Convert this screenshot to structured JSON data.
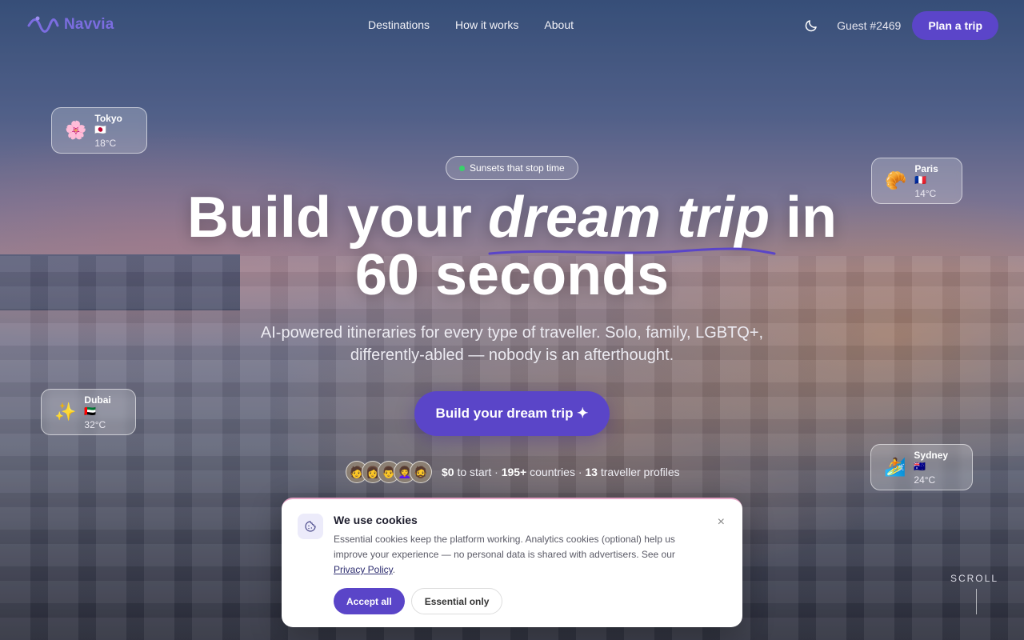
{
  "brand": {
    "name": "Navvia",
    "accent": "#5a45c8"
  },
  "nav": {
    "links": [
      "Destinations",
      "How it works",
      "About"
    ],
    "theme_icon": "moon-icon",
    "guest_label": "Guest #2469",
    "plan_label": "Plan a trip"
  },
  "chips": [
    {
      "emoji": "🌸",
      "city": "Tokyo 🇯🇵",
      "temp": "18°C"
    },
    {
      "emoji": "🥐",
      "city": "Paris 🇫🇷",
      "temp": "14°C"
    },
    {
      "emoji": "✨",
      "city": "Dubai 🇦🇪",
      "temp": "32°C"
    },
    {
      "emoji": "🏄",
      "city": "Sydney 🇦🇺",
      "temp": "24°C"
    }
  ],
  "hero": {
    "tag": "Sunsets that stop time",
    "headline_pre": "Build your ",
    "headline_em": "dream trip",
    "headline_post": " in",
    "headline_line2": "60 seconds",
    "subtitle_line1": "AI-powered itineraries for every type of traveller. Solo, family, LGBTQ+,",
    "subtitle_line2": "differently-abled — nobody is an afterthought.",
    "cta_label": "Build your dream trip ✦"
  },
  "proof": {
    "avatars": [
      "🧑",
      "👩",
      "👨",
      "👩‍🦱",
      "🧔"
    ],
    "price": "$0",
    "price_suffix": " to start · ",
    "countries": "195+",
    "countries_suffix": " countries · ",
    "profiles": "13",
    "profiles_suffix": " traveller profiles"
  },
  "scroll_label": "SCROLL",
  "cookie": {
    "title": "We use cookies",
    "body": "Essential cookies keep the platform working. Analytics cookies (optional) help us improve your experience — no personal data is shared with advertisers. See our ",
    "policy_link": "Privacy Policy",
    "body_end": ".",
    "close": "×",
    "accept_label": "Accept all",
    "essential_label": "Essential only"
  }
}
